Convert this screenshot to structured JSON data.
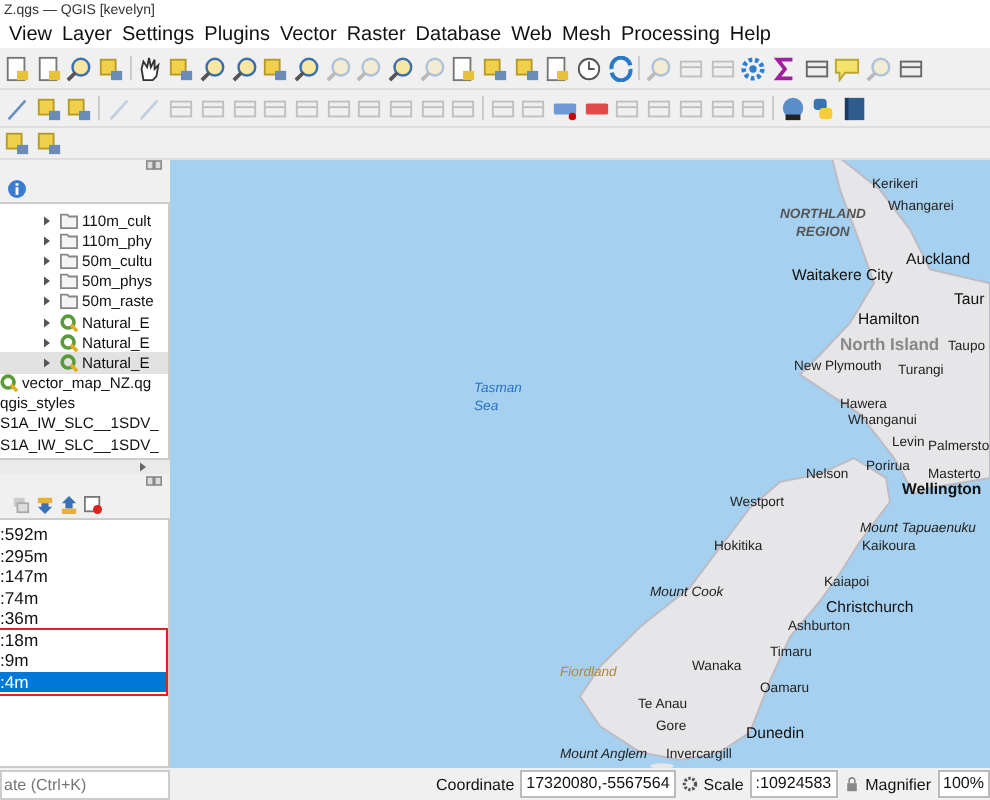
{
  "window": {
    "title": "Z.qgs — QGIS [kevelyn]"
  },
  "menu": [
    "View",
    "Layer",
    "Settings",
    "Plugins",
    "Vector",
    "Raster",
    "Database",
    "Web",
    "Mesh",
    "Processing",
    "Help"
  ],
  "browser": {
    "items": [
      {
        "label": "110m_cult",
        "kind": "folder",
        "selected": false
      },
      {
        "label": "110m_phy",
        "kind": "folder",
        "selected": false
      },
      {
        "label": "50m_cultu",
        "kind": "folder",
        "selected": false
      },
      {
        "label": "50m_phys",
        "kind": "folder",
        "selected": false
      },
      {
        "label": "50m_raste",
        "kind": "folder",
        "selected": false
      },
      {
        "label": "Natural_E",
        "kind": "project",
        "selected": false
      },
      {
        "label": "Natural_E",
        "kind": "project",
        "selected": false
      },
      {
        "label": "Natural_E",
        "kind": "project",
        "selected": true
      },
      {
        "label": "vector_map_NZ.qg",
        "kind": "project-root",
        "selected": false
      },
      {
        "label": "qgis_styles",
        "kind": "plain",
        "selected": false
      },
      {
        "label": "S1A_IW_SLC__1SDV_",
        "kind": "plain",
        "selected": false
      },
      {
        "label": "S1A_IW_SLC__1SDV_",
        "kind": "plain",
        "selected": false
      }
    ]
  },
  "scales": {
    "items": [
      {
        "label": ":592m",
        "selected": false
      },
      {
        "label": ":295m",
        "selected": false
      },
      {
        "label": ":147m",
        "selected": false
      },
      {
        "label": ":74m",
        "selected": false
      },
      {
        "label": ":36m",
        "selected": false
      },
      {
        "label": ":18m",
        "selected": false
      },
      {
        "label": ":9m",
        "selected": false
      },
      {
        "label": ":4m",
        "selected": true
      }
    ]
  },
  "locator": {
    "placeholder": "ate (Ctrl+K)"
  },
  "map": {
    "labels": [
      {
        "text": "Kerikeri",
        "kind": "town"
      },
      {
        "text": "Whangarei",
        "kind": "town"
      },
      {
        "text": "NORTHLAND",
        "kind": "region"
      },
      {
        "text": "REGION",
        "kind": "region"
      },
      {
        "text": "Auckland",
        "kind": "city"
      },
      {
        "text": "Waitakere City",
        "kind": "city"
      },
      {
        "text": "Taur",
        "kind": "city"
      },
      {
        "text": "Hamilton",
        "kind": "city"
      },
      {
        "text": "North Island",
        "kind": "island"
      },
      {
        "text": "Taupo",
        "kind": "town"
      },
      {
        "text": "New Plymouth",
        "kind": "town"
      },
      {
        "text": "Turangi",
        "kind": "town"
      },
      {
        "text": "Hawera",
        "kind": "town"
      },
      {
        "text": "Whanganui",
        "kind": "town"
      },
      {
        "text": "Levin",
        "kind": "town"
      },
      {
        "text": "Palmersto",
        "kind": "town"
      },
      {
        "text": "Porirua",
        "kind": "town"
      },
      {
        "text": "Masterto",
        "kind": "town"
      },
      {
        "text": "Nelson",
        "kind": "town"
      },
      {
        "text": "Wellington",
        "kind": "capital"
      },
      {
        "text": "Westport",
        "kind": "town"
      },
      {
        "text": "Mount Tapuaenuku",
        "kind": "mountain"
      },
      {
        "text": "Hokitika",
        "kind": "town"
      },
      {
        "text": "Kaikoura",
        "kind": "town"
      },
      {
        "text": "Kaiapoi",
        "kind": "town"
      },
      {
        "text": "Christchurch",
        "kind": "city"
      },
      {
        "text": "Mount Cook",
        "kind": "mountain"
      },
      {
        "text": "Ashburton",
        "kind": "town"
      },
      {
        "text": "Timaru",
        "kind": "town"
      },
      {
        "text": "Wanaka",
        "kind": "town"
      },
      {
        "text": "Oamaru",
        "kind": "town"
      },
      {
        "text": "Fiordland",
        "kind": "park"
      },
      {
        "text": "Te Anau",
        "kind": "town"
      },
      {
        "text": "Gore",
        "kind": "town"
      },
      {
        "text": "Dunedin",
        "kind": "city"
      },
      {
        "text": "Mount Anglem",
        "kind": "mountain"
      },
      {
        "text": "Invercargill",
        "kind": "town"
      },
      {
        "text": "Tasman",
        "kind": "sea"
      },
      {
        "text": "Sea",
        "kind": "sea"
      }
    ]
  },
  "status_bar": {
    "coordinate_label": "Coordinate",
    "coordinate": "17320080,-5567564",
    "scale_label": "Scale",
    "scale": ":10924583",
    "magnifier_label": "Magnifier",
    "magnifier": "100%"
  }
}
